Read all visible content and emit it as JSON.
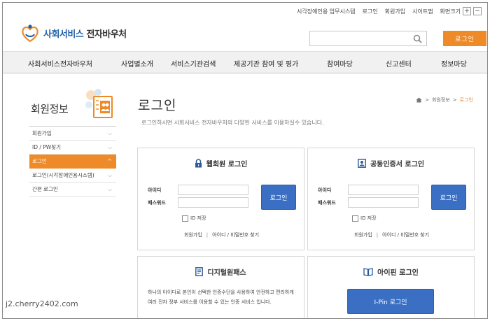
{
  "util_links": [
    "시각장애인용 업무시스템",
    "로그인",
    "회원가입",
    "사이트맵",
    "화면크기"
  ],
  "zoom": {
    "plus": "+",
    "minus": "−"
  },
  "logo": {
    "part1": "사회서비스",
    "part2": " 전자바우처"
  },
  "search": {
    "placeholder": ""
  },
  "header_login": "로그인",
  "nav": [
    "사회서비스전자바우처",
    "사업별소개",
    "서비스기관검색",
    "제공기관 참여 및 평가",
    "참여마당",
    "신고센터",
    "정보마당"
  ],
  "sidebar": {
    "title": "회원정보",
    "items": [
      {
        "label": "회원가입",
        "active": false
      },
      {
        "label": "ID / PW찾기",
        "active": false
      },
      {
        "label": "로그인",
        "active": true
      },
      {
        "label": "로그인(시각장애인용시스템)",
        "active": false
      },
      {
        "label": "간편 로그인",
        "active": false
      }
    ]
  },
  "main": {
    "title": "로그인",
    "breadcrumb": [
      "회원정보",
      "로그인"
    ],
    "intro": "로그인하시면 사회서비스 전자바우처의 다양한 서비스를 이용하실수 있습니다."
  },
  "web_login": {
    "title": "웹회원 로그인",
    "id_label": "아이디",
    "pw_label": "패스워드",
    "button": "로그인",
    "save_id": "ID 저장",
    "link_join": "회원가입",
    "link_find": "아이디 / 비밀번호 찾기"
  },
  "cert_login": {
    "title": "공동인증서 로그인",
    "id_label": "아이디",
    "pw_label": "패스워드",
    "button": "로그인",
    "save_id": "ID 저장",
    "link_join": "회원가입",
    "link_find": "아이디 / 비밀번호 찾기"
  },
  "digital_onepass": {
    "title": "디지털원패스",
    "desc": "하나의 아이디로 본인이 선택한 인증수단을 사용하여 안전하고 편리하게 여러 전자 정부 서비스를 이용할 수 있는 인증 서비스 입니다."
  },
  "ipin": {
    "title": "아이핀 로그인",
    "button": "I-Pin 로그인"
  },
  "watermark": "j2.cherry2402.com",
  "colors": {
    "accent": "#ef8a28",
    "button_blue": "#3a6fc4",
    "logo_blue": "#1e5fa8"
  }
}
